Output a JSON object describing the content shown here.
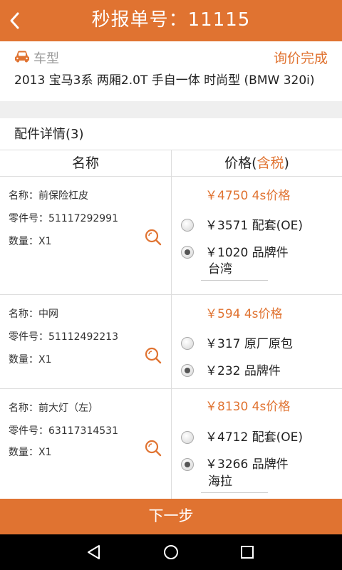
{
  "header": {
    "title": "秒报单号：11115",
    "back_icon": "back-arrow-icon"
  },
  "car": {
    "label": "车型",
    "status": "询价完成",
    "model": "2013 宝马3系 两厢2.0T 手自一体 时尚型 (BMW 320i)",
    "icon": "car-icon"
  },
  "details": {
    "title": "配件详情(3)"
  },
  "table": {
    "col_name": "名称",
    "col_price": "价格(",
    "col_price_tax": "含税",
    "col_price_end": ")"
  },
  "parts": [
    {
      "name": "名称：前保险杠皮",
      "number": "零件号：51117292991",
      "qty": "数量：X1",
      "ref_price": "￥4750 4s价格",
      "options": [
        {
          "text": "￥3571 配套(OE)",
          "checked": false
        },
        {
          "text": "￥1020 品牌件",
          "checked": true
        }
      ],
      "brand": "台湾"
    },
    {
      "name": "名称：中网",
      "number": "零件号：51112492213",
      "qty": "数量：X1",
      "ref_price": "￥594 4s价格",
      "options": [
        {
          "text": "￥317 原厂原包",
          "checked": false
        },
        {
          "text": "￥232 品牌件",
          "checked": true
        }
      ],
      "brand": ""
    },
    {
      "name": "名称：前大灯（左）",
      "number": "零件号：63117314531",
      "qty": "数量：X1",
      "ref_price": "￥8130 4s价格",
      "options": [
        {
          "text": "￥4712 配套(OE)",
          "checked": false
        },
        {
          "text": "￥3266 品牌件",
          "checked": true
        }
      ],
      "brand": "海拉"
    }
  ],
  "footer": {
    "next_label": "下一步"
  },
  "colors": {
    "accent": "#e07331",
    "nav_bg": "#000000",
    "gap_bg": "#efefef"
  }
}
